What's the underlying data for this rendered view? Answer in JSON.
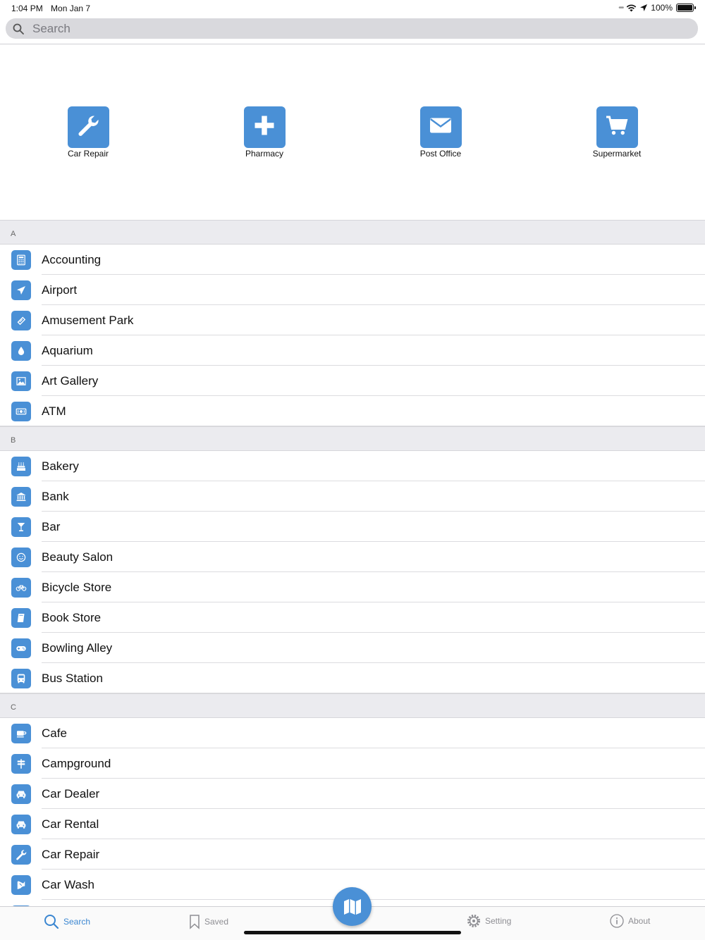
{
  "status": {
    "time": "1:04 PM",
    "date": "Mon Jan 7",
    "battery": "100%",
    "battery_level": 1.0
  },
  "search": {
    "placeholder": "Search"
  },
  "featured": [
    {
      "label": "Car Repair",
      "icon": "wrench-icon"
    },
    {
      "label": "Pharmacy",
      "icon": "plus-icon"
    },
    {
      "label": "Post Office",
      "icon": "envelope-icon"
    },
    {
      "label": "Supermarket",
      "icon": "cart-icon"
    }
  ],
  "sections": [
    {
      "letter": "A",
      "items": [
        {
          "label": "Accounting",
          "icon": "calculator-icon"
        },
        {
          "label": "Airport",
          "icon": "plane-icon"
        },
        {
          "label": "Amusement Park",
          "icon": "ticket-icon"
        },
        {
          "label": "Aquarium",
          "icon": "droplet-icon"
        },
        {
          "label": "Art Gallery",
          "icon": "picture-icon"
        },
        {
          "label": "ATM",
          "icon": "money-icon"
        }
      ]
    },
    {
      "letter": "B",
      "items": [
        {
          "label": "Bakery",
          "icon": "cake-icon"
        },
        {
          "label": "Bank",
          "icon": "bank-icon"
        },
        {
          "label": "Bar",
          "icon": "cocktail-icon"
        },
        {
          "label": "Beauty Salon",
          "icon": "smile-icon"
        },
        {
          "label": "Bicycle Store",
          "icon": "bicycle-icon"
        },
        {
          "label": "Book Store",
          "icon": "book-icon"
        },
        {
          "label": "Bowling Alley",
          "icon": "gamepad-icon"
        },
        {
          "label": "Bus Station",
          "icon": "bus-icon"
        }
      ]
    },
    {
      "letter": "C",
      "items": [
        {
          "label": "Cafe",
          "icon": "coffee-icon"
        },
        {
          "label": "Campground",
          "icon": "signpost-icon"
        },
        {
          "label": "Car Dealer",
          "icon": "car-icon"
        },
        {
          "label": "Car Rental",
          "icon": "car-icon"
        },
        {
          "label": "Car Repair",
          "icon": "wrench-icon"
        },
        {
          "label": "Car Wash",
          "icon": "car-wash-icon"
        }
      ]
    }
  ],
  "tabs": [
    {
      "label": "Search",
      "icon": "search-icon",
      "active": true
    },
    {
      "label": "Saved",
      "icon": "bookmark-icon",
      "active": false
    },
    {
      "label": "Setting",
      "icon": "gear-icon",
      "active": false
    },
    {
      "label": "About",
      "icon": "info-icon",
      "active": false
    }
  ],
  "map_button": {
    "icon": "map-icon"
  },
  "colors": {
    "accent": "#4a90d6",
    "active_tab": "#3a86d1",
    "section_bg": "#ebebef"
  }
}
